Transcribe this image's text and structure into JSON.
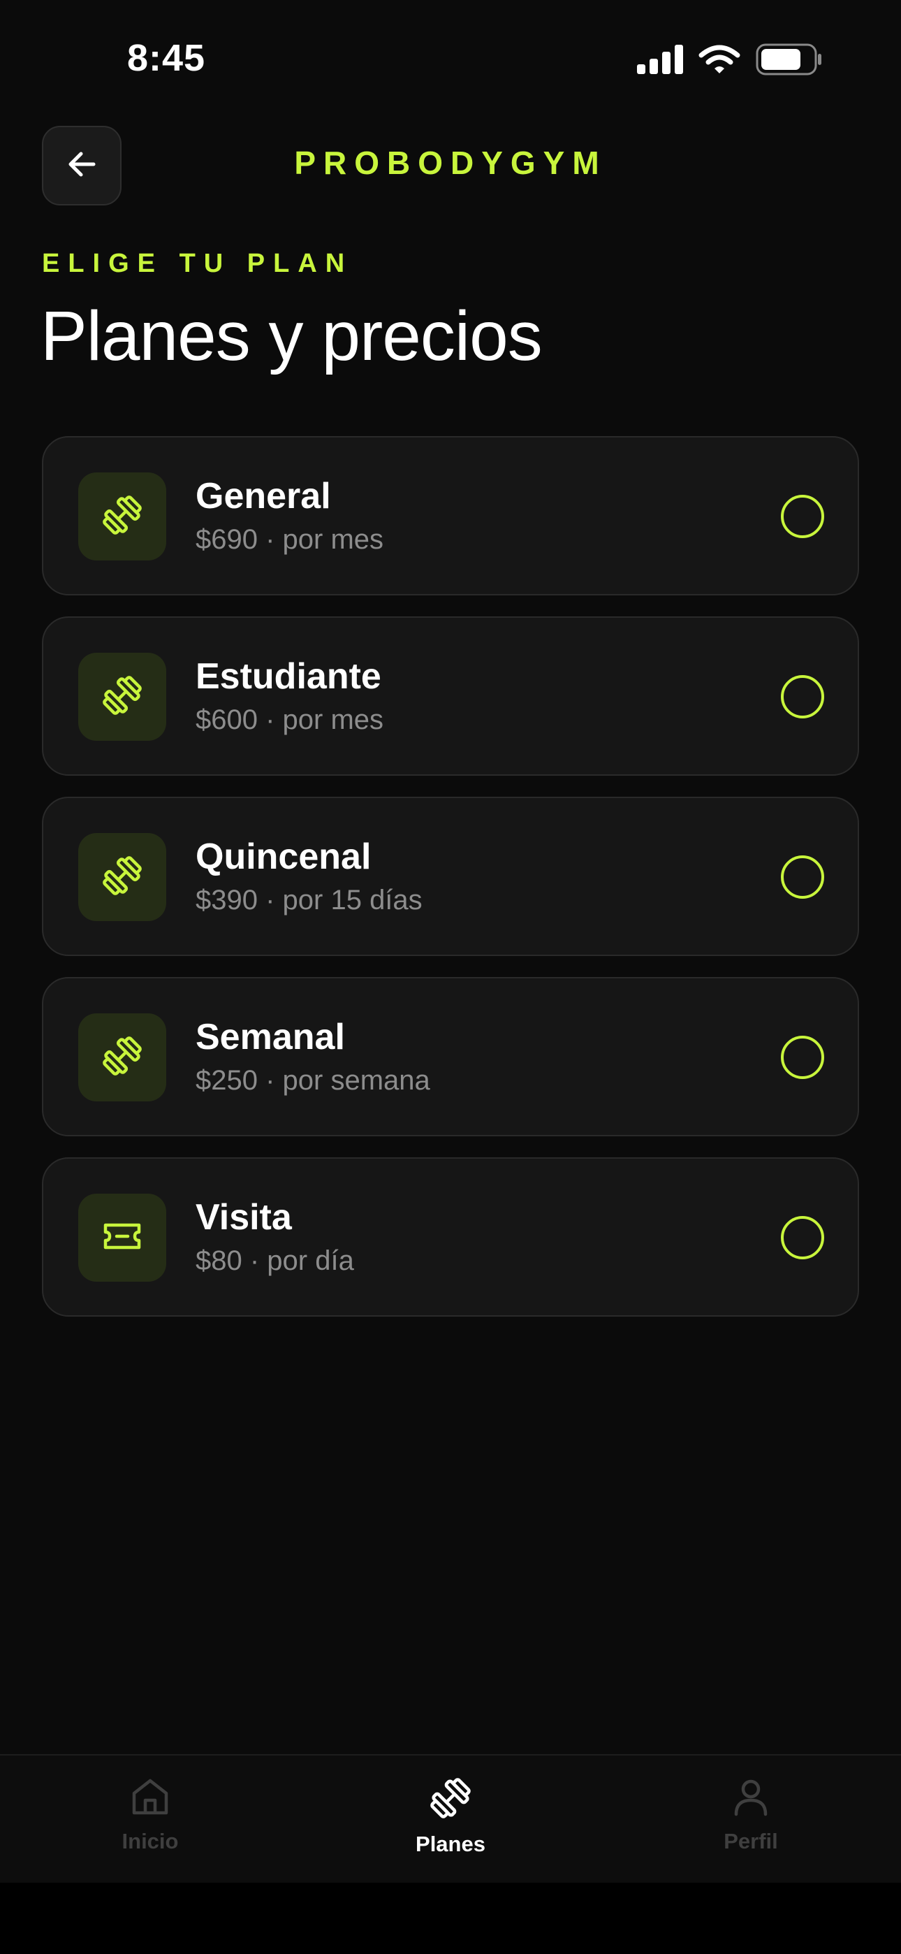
{
  "status_bar": {
    "time": "8:45",
    "icons": [
      "cellular-signal-icon",
      "wifi-icon",
      "battery-icon"
    ]
  },
  "header": {
    "back_icon": "arrow-left-icon",
    "brand": "PROBODYGYM"
  },
  "intro": {
    "eyebrow": "ELIGE TU PLAN",
    "title": "Planes y precios"
  },
  "plans": [
    {
      "name": "General",
      "price": "$690 · por mes",
      "icon": "dumbbell-icon"
    },
    {
      "name": "Estudiante",
      "price": "$600 · por mes",
      "icon": "dumbbell-icon"
    },
    {
      "name": "Quincenal",
      "price": "$390 · por 15 días",
      "icon": "dumbbell-icon"
    },
    {
      "name": "Semanal",
      "price": "$250 · por semana",
      "icon": "dumbbell-icon"
    },
    {
      "name": "Visita",
      "price": "$80 · por día",
      "icon": "ticket-icon"
    }
  ],
  "tab_bar": {
    "tabs": [
      {
        "label": "Inicio",
        "icon": "home-icon",
        "active": false
      },
      {
        "label": "Planes",
        "icon": "dumbbell-icon",
        "active": true
      },
      {
        "label": "Perfil",
        "icon": "user-icon",
        "active": false
      }
    ]
  },
  "colors": {
    "accent": "#c8f53c",
    "background": "#0b0b0b",
    "card": "#161616",
    "muted_text": "#8d8d8d",
    "inactive_tab": "#3f3f3f"
  }
}
